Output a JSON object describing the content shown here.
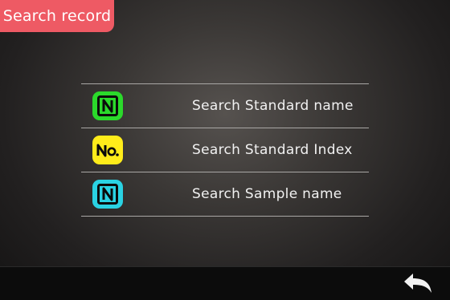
{
  "header": {
    "title": "Search record"
  },
  "menu": {
    "items": [
      {
        "label": "Search Standard name",
        "icon": "n-icon",
        "icon_color": "#2bd92b"
      },
      {
        "label": "Search Standard Index",
        "icon": "no-icon",
        "icon_color": "#ffec1a"
      },
      {
        "label": "Search Sample name",
        "icon": "n-icon",
        "icon_color": "#2ad2e3"
      }
    ]
  },
  "footer": {
    "back_icon": "back-arrow-icon"
  },
  "colors": {
    "accent": "#ee5a64"
  }
}
